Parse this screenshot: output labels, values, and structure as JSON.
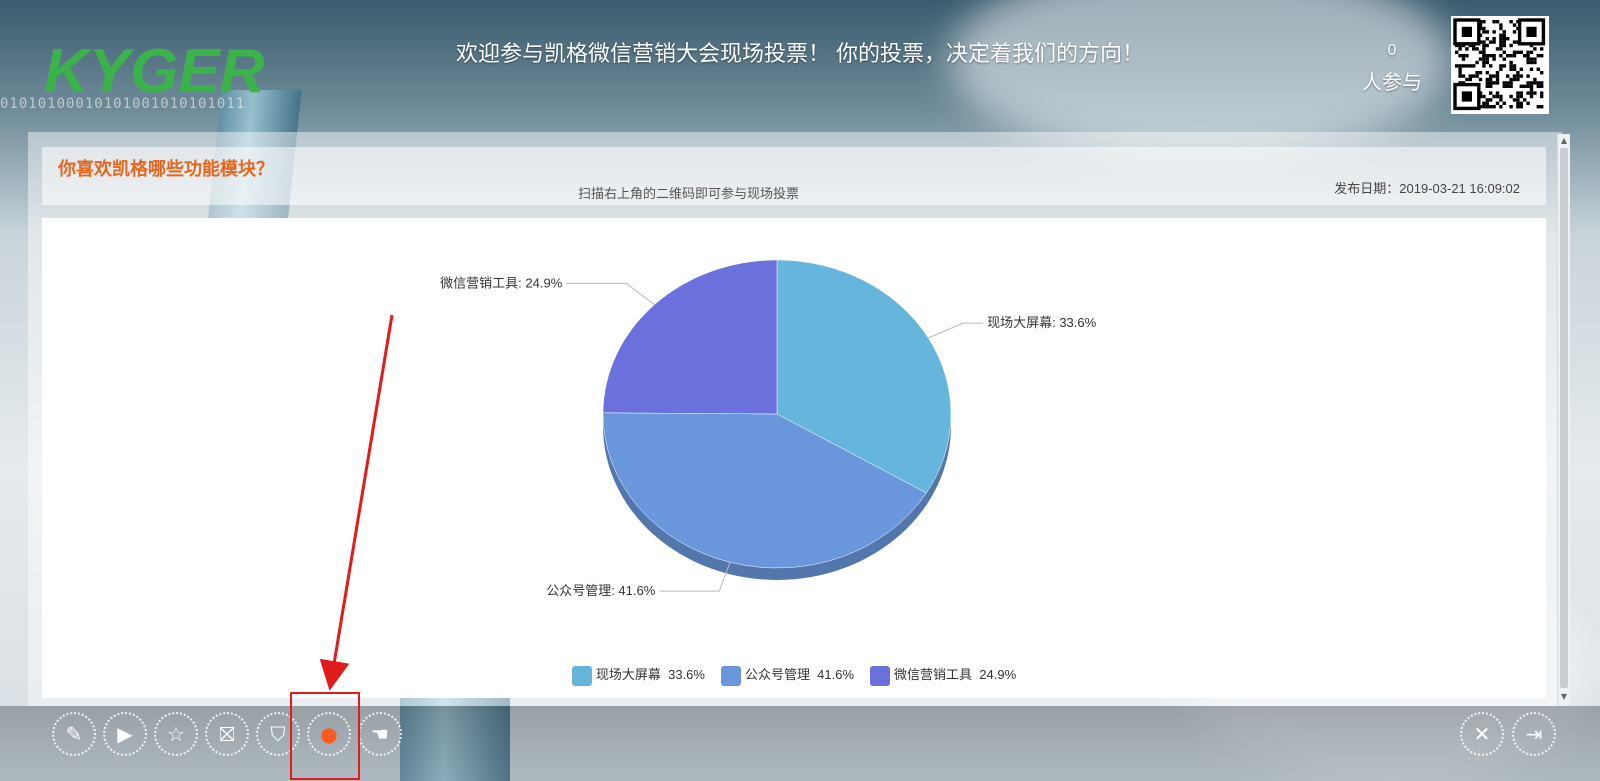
{
  "header": {
    "logo_text": "KYGER",
    "banner_title": "欢迎参与凯格微信营销大会现场投票！ 你的投票，决定着我们的方向！",
    "participants_count": "0",
    "participants_label": "人参与"
  },
  "question": {
    "title": "你喜欢凯格哪些功能模块？",
    "hint": "扫描右上角的二维码即可参与现场投票",
    "publish_date": "发布日期：2019-03-21 16:09:02"
  },
  "chart_data": {
    "type": "pie",
    "categories": [
      "现场大屏幕",
      "公众号管理",
      "微信营销工具"
    ],
    "values": [
      33.6,
      41.6,
      24.9
    ],
    "unit": "%",
    "colors": [
      "#66b5dc",
      "#6a97dc",
      "#6a70dc"
    ],
    "data_labels": [
      "现场大屏幕: 33.6%",
      "公众号管理: 41.6%",
      "微信营销工具: 24.9%"
    ],
    "legend": [
      "现场大屏幕  33.6%",
      "公众号管理  41.6%",
      "微信营销工具  24.9%"
    ],
    "legend_placement": "bottom"
  },
  "toolbar": {
    "buttons": [
      {
        "name": "edit",
        "icon": "pencil-icon",
        "glyph": "✎"
      },
      {
        "name": "play",
        "icon": "play-icon",
        "glyph": "▶"
      },
      {
        "name": "favorite",
        "icon": "star-icon",
        "glyph": "☆"
      },
      {
        "name": "gift",
        "icon": "gift-icon",
        "glyph": "⛝"
      },
      {
        "name": "shirt",
        "icon": "shirt-icon",
        "glyph": "⛉"
      },
      {
        "name": "vote",
        "icon": "vote-icon",
        "glyph": "●"
      },
      {
        "name": "more",
        "icon": "hand-icon",
        "glyph": "☚"
      }
    ],
    "fullscreen_icon": "fullscreen-icon",
    "exit_icon": "exit-icon",
    "accent_color": "#ff5a1e"
  }
}
